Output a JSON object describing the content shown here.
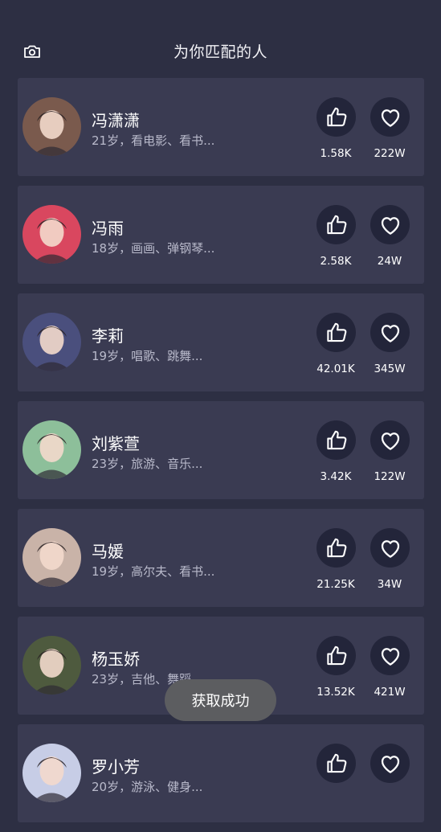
{
  "header": {
    "title": "为你匹配的人",
    "camera_icon": "camera-icon"
  },
  "users": [
    {
      "name": "冯潇潇",
      "info": "21岁，看电影、看书...",
      "likes": "1.58K",
      "favorites": "222W",
      "avatar_color": "#7a5a4d"
    },
    {
      "name": "冯雨",
      "info": "18岁，画画、弹钢琴...",
      "likes": "2.58K",
      "favorites": "24W",
      "avatar_color": "#d9475f"
    },
    {
      "name": "李莉",
      "info": "19岁，唱歌、跳舞...",
      "likes": "42.01K",
      "favorites": "345W",
      "avatar_color": "#4a4f7d"
    },
    {
      "name": "刘紫萱",
      "info": "23岁，旅游、音乐...",
      "likes": "3.42K",
      "favorites": "122W",
      "avatar_color": "#8dbf9a"
    },
    {
      "name": "马媛",
      "info": "19岁，高尔夫、看书...",
      "likes": "21.25K",
      "favorites": "34W",
      "avatar_color": "#c9b3a8"
    },
    {
      "name": "杨玉娇",
      "info": "23岁，吉他、舞蹈...",
      "likes": "13.52K",
      "favorites": "421W",
      "avatar_color": "#4e5a3e"
    },
    {
      "name": "罗小芳",
      "info": "20岁，游泳、健身...",
      "likes": "",
      "favorites": "",
      "avatar_color": "#c7cde6"
    }
  ],
  "toast": {
    "text": "获取成功"
  },
  "colors": {
    "background": "#2d2f43",
    "card": "#3a3b52",
    "button": "#23253a"
  }
}
